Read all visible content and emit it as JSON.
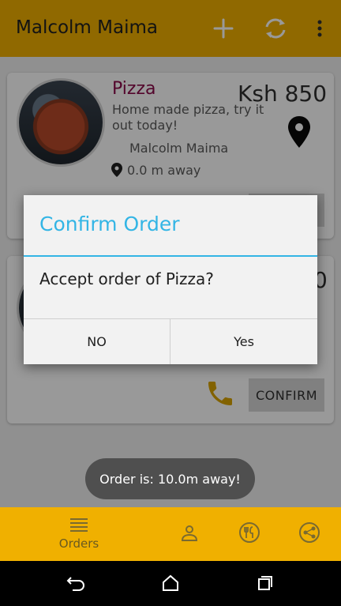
{
  "app_bar": {
    "title": "Malcolm Maima",
    "icons": [
      "add-icon",
      "sync-icon",
      "more-vert-icon"
    ],
    "accent_color": "#f0b000"
  },
  "orders": [
    {
      "title": "Pizza",
      "price": "Ksh 850",
      "description": "Home made pizza, try it out today!",
      "seller": "Malcolm Maima",
      "distance": "0.0 m away"
    },
    {
      "price_fragment": "0",
      "confirm_label": "CONFIRM"
    }
  ],
  "dialog": {
    "title": "Confirm Order",
    "message": "Accept order of Pizza?",
    "negative": "NO",
    "positive": "Yes",
    "title_color": "#33b5e5"
  },
  "toast": {
    "text": "Order is: 10.0m away!"
  },
  "bottom_nav": {
    "items": [
      {
        "label": "Orders",
        "icon": "list-icon"
      },
      {
        "label": "",
        "icon": "person-icon"
      },
      {
        "label": "",
        "icon": "restaurant-icon"
      },
      {
        "label": "",
        "icon": "share-circle-icon"
      }
    ]
  },
  "system_nav": [
    "back-icon",
    "home-icon",
    "recents-icon"
  ]
}
